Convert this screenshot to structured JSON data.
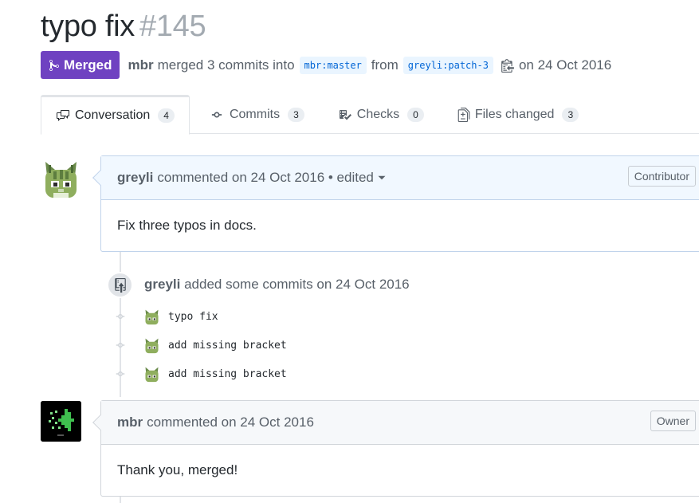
{
  "pr": {
    "title": "typo fix",
    "number": "#145",
    "state": "Merged",
    "merger": "mbr",
    "merge_text": "merged 3 commits into",
    "base_branch": "mbr:master",
    "from_text": "from",
    "head_branch": "greyli:patch-3",
    "date_text": "on 24 Oct 2016"
  },
  "tabs": [
    {
      "label": "Conversation",
      "count": "4",
      "icon": "comment-discussion-icon"
    },
    {
      "label": "Commits",
      "count": "3",
      "icon": "git-commit-icon"
    },
    {
      "label": "Checks",
      "count": "0",
      "icon": "checklist-icon"
    },
    {
      "label": "Files changed",
      "count": "3",
      "icon": "file-diff-icon"
    }
  ],
  "comments": [
    {
      "author": "greyli",
      "meta": "commented on 24 Oct 2016 • edited",
      "badge": "Contributor",
      "body": "Fix three typos in docs."
    },
    {
      "author": "mbr",
      "meta": "commented on 24 Oct 2016",
      "badge": "Owner",
      "body": "Thank you, merged!"
    }
  ],
  "push_event": {
    "author": "greyli",
    "text": "added some commits on 24 Oct 2016"
  },
  "commits": [
    {
      "message": "typo fix"
    },
    {
      "message": "add missing bracket"
    },
    {
      "message": "add missing bracket"
    }
  ],
  "colors": {
    "merged": "#6f42c1",
    "link": "#0366d6",
    "header_bg": "#f1f8ff"
  }
}
